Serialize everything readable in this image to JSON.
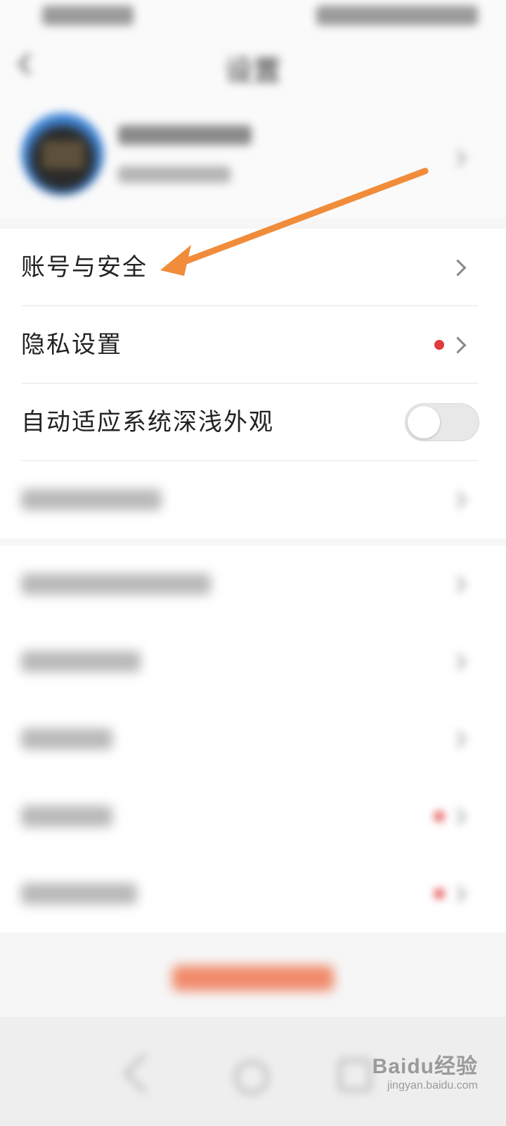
{
  "header": {
    "title": "设置"
  },
  "settings": {
    "items": [
      {
        "label": "账号与安全"
      },
      {
        "label": "隐私设置",
        "has_red_dot": true
      },
      {
        "label": "自动适应系统深浅外观",
        "toggle_on": false
      }
    ]
  },
  "watermark": {
    "logo": "Baidu经验",
    "sub": "jingyan.baidu.com"
  },
  "colors": {
    "accent_red": "#e03a3a",
    "arrow": "#f08c3a",
    "toggle_off": "#e8e8e8"
  },
  "icons": [
    "back-icon",
    "chevron-right-icon",
    "red-dot-icon",
    "toggle-switch",
    "arrow-annotation"
  ]
}
